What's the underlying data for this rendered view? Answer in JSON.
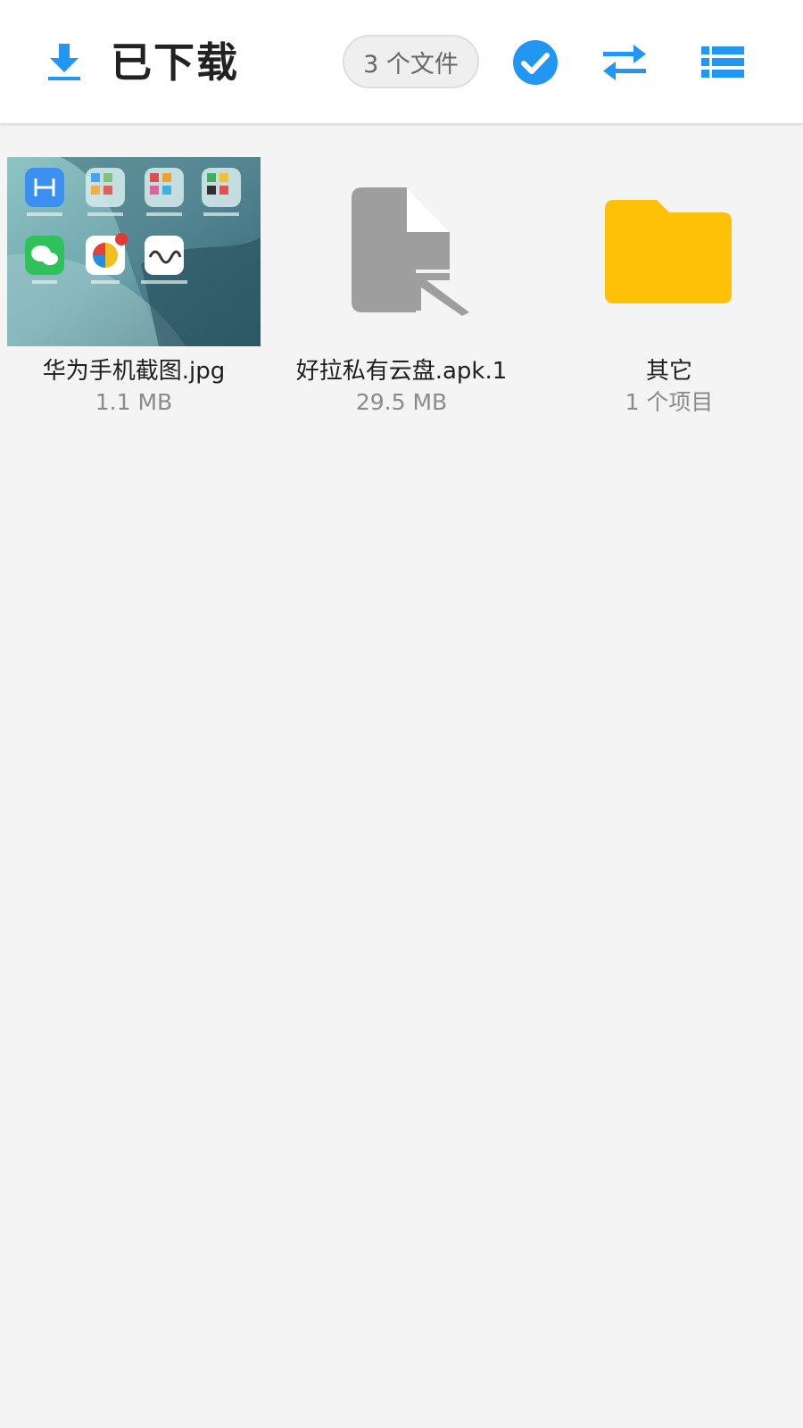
{
  "header": {
    "title": "已下载",
    "file_count_label": "3 个文件",
    "icons": {
      "download": "download-icon",
      "select_all": "check-circle-icon",
      "sort": "swap-arrows-icon",
      "view": "list-view-icon"
    },
    "accent_color": "#2196f3"
  },
  "items": [
    {
      "name": "华为手机截图.jpg",
      "meta": "1.1 MB",
      "type": "image",
      "icon": "image-thumbnail"
    },
    {
      "name": "好拉私有云盘.apk.1",
      "meta": "29.5 MB",
      "type": "file",
      "icon": "file-shortcut-icon"
    },
    {
      "name": "其它",
      "meta": "1 个项目",
      "type": "folder",
      "icon": "folder-icon"
    }
  ],
  "colors": {
    "folder": "#ffc107",
    "file_icon": "#9e9e9e",
    "background": "#f4f4f4"
  }
}
